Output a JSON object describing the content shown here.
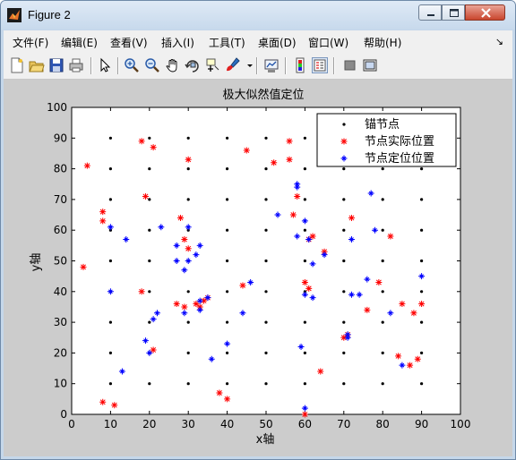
{
  "window": {
    "title": "Figure 2"
  },
  "menubar": {
    "items": [
      {
        "label": "文件(F)"
      },
      {
        "label": "编辑(E)"
      },
      {
        "label": "查看(V)"
      },
      {
        "label": "插入(I)"
      },
      {
        "label": "工具(T)"
      },
      {
        "label": "桌面(D)"
      },
      {
        "label": "窗口(W)"
      },
      {
        "label": "帮助(H)"
      }
    ],
    "overflow_glyph": "↘"
  },
  "toolbar": {
    "icons": [
      "new-figure-icon",
      "open-file-icon",
      "save-icon",
      "print-icon",
      "edit-plot-arrow-icon",
      "zoom-in-icon",
      "zoom-out-icon",
      "pan-icon",
      "rotate-3d-icon",
      "data-cursor-icon",
      "brush-icon",
      "brush-dropdown-icon",
      "link-plot-icon",
      "colorbar-icon",
      "legend-icon",
      "hide-plot-tools-icon",
      "show-plot-tools-icon"
    ]
  },
  "colors": {
    "anchor": "#000000",
    "actual": "#ff0000",
    "estimated": "#0000ff",
    "figure_bg": "#cccccc"
  },
  "chart_data": {
    "type": "scatter",
    "title": "极大似然值定位",
    "xlabel": "x轴",
    "ylabel": "y轴",
    "xlim": [
      0,
      100
    ],
    "ylim": [
      0,
      100
    ],
    "xticks": [
      0,
      10,
      20,
      30,
      40,
      50,
      60,
      70,
      80,
      90,
      100
    ],
    "yticks": [
      0,
      10,
      20,
      30,
      40,
      50,
      60,
      70,
      80,
      90,
      100
    ],
    "grid": false,
    "legend_position": "top-right",
    "series": [
      {
        "name": "锚节点",
        "marker": "dot",
        "color": "#000000",
        "grid_x": [
          10,
          20,
          30,
          40,
          50,
          60,
          70,
          80,
          90
        ],
        "grid_y": [
          10,
          20,
          30,
          40,
          50,
          60,
          70,
          80,
          90
        ]
      },
      {
        "name": "节点实际位置",
        "marker": "star",
        "color": "#ff0000",
        "points": [
          [
            4,
            81
          ],
          [
            3,
            48
          ],
          [
            8,
            63
          ],
          [
            8,
            66
          ],
          [
            8,
            4
          ],
          [
            11,
            3
          ],
          [
            18,
            89
          ],
          [
            21,
            87
          ],
          [
            19,
            71
          ],
          [
            18,
            40
          ],
          [
            21,
            21
          ],
          [
            28,
            64
          ],
          [
            30,
            83
          ],
          [
            29,
            57
          ],
          [
            30,
            54
          ],
          [
            27,
            36
          ],
          [
            29,
            35
          ],
          [
            32,
            36
          ],
          [
            33,
            35
          ],
          [
            34,
            37
          ],
          [
            35,
            38
          ],
          [
            38,
            7
          ],
          [
            40,
            5
          ],
          [
            44,
            42
          ],
          [
            45,
            86
          ],
          [
            52,
            82
          ],
          [
            56,
            89
          ],
          [
            56,
            83
          ],
          [
            57,
            65
          ],
          [
            58,
            71
          ],
          [
            60,
            43
          ],
          [
            61,
            41
          ],
          [
            60,
            0
          ],
          [
            61,
            57
          ],
          [
            62,
            58
          ],
          [
            64,
            14
          ],
          [
            65,
            53
          ],
          [
            70,
            25
          ],
          [
            71,
            26
          ],
          [
            72,
            64
          ],
          [
            76,
            34
          ],
          [
            79,
            43
          ],
          [
            82,
            58
          ],
          [
            84,
            19
          ],
          [
            85,
            36
          ],
          [
            87,
            16
          ],
          [
            88,
            33
          ],
          [
            89,
            18
          ],
          [
            90,
            36
          ]
        ]
      },
      {
        "name": "节点定位位置",
        "marker": "plus",
        "color": "#0000ff",
        "points": [
          [
            10,
            61
          ],
          [
            10,
            40
          ],
          [
            14,
            57
          ],
          [
            13,
            14
          ],
          [
            19,
            24
          ],
          [
            20,
            20
          ],
          [
            21,
            31
          ],
          [
            22,
            33
          ],
          [
            23,
            61
          ],
          [
            27,
            55
          ],
          [
            27,
            50
          ],
          [
            29,
            47
          ],
          [
            30,
            61
          ],
          [
            29,
            33
          ],
          [
            30,
            50
          ],
          [
            32,
            52
          ],
          [
            33,
            55
          ],
          [
            33,
            37
          ],
          [
            33,
            34
          ],
          [
            35,
            38
          ],
          [
            36,
            18
          ],
          [
            40,
            23
          ],
          [
            44,
            33
          ],
          [
            46,
            43
          ],
          [
            53,
            65
          ],
          [
            58,
            74
          ],
          [
            58,
            75
          ],
          [
            58,
            58
          ],
          [
            59,
            22
          ],
          [
            60,
            39
          ],
          [
            60,
            63
          ],
          [
            60,
            2
          ],
          [
            61,
            57
          ],
          [
            62,
            49
          ],
          [
            62,
            38
          ],
          [
            65,
            52
          ],
          [
            71,
            26
          ],
          [
            71,
            25
          ],
          [
            72,
            57
          ],
          [
            72,
            39
          ],
          [
            74,
            39
          ],
          [
            76,
            44
          ],
          [
            77,
            72
          ],
          [
            78,
            60
          ],
          [
            82,
            33
          ],
          [
            85,
            16
          ],
          [
            90,
            45
          ]
        ]
      }
    ]
  }
}
